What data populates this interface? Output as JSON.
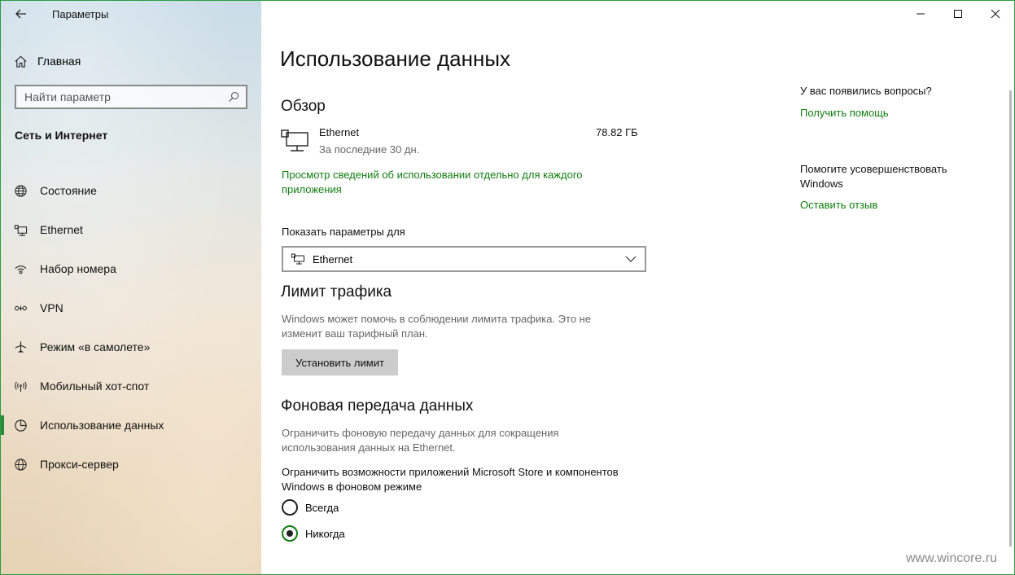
{
  "window": {
    "title": "Параметры",
    "minimize_icon": "minimize-icon",
    "maximize_icon": "maximize-icon",
    "close_icon": "close-icon",
    "accent": "#107c10"
  },
  "sidebar": {
    "home_label": "Главная",
    "search_placeholder": "Найти параметр",
    "section_title": "Сеть и Интернет",
    "items": [
      {
        "label": "Состояние",
        "icon": "globe-status-icon"
      },
      {
        "label": "Ethernet",
        "icon": "ethernet-icon"
      },
      {
        "label": "Набор номера",
        "icon": "dial-up-icon"
      },
      {
        "label": "VPN",
        "icon": "vpn-icon"
      },
      {
        "label": "Режим «в самолете»",
        "icon": "airplane-icon"
      },
      {
        "label": "Мобильный хот-спот",
        "icon": "hotspot-icon"
      },
      {
        "label": "Использование данных",
        "icon": "data-usage-icon",
        "active": true
      },
      {
        "label": "Прокси-сервер",
        "icon": "globe-icon"
      }
    ]
  },
  "main": {
    "title": "Использование данных",
    "overview": {
      "title": "Обзор",
      "network_name": "Ethernet",
      "period": "За последние 30 дн.",
      "usage": "78.82 ГБ",
      "details_link": "Просмотр сведений об использовании отдельно для каждого приложения"
    },
    "show_settings": {
      "label": "Показать параметры для",
      "selected": "Ethernet"
    },
    "limit": {
      "title": "Лимит трафика",
      "description": "Windows может помочь в соблюдении лимита трафика. Это не изменит ваш тарифный план.",
      "button": "Установить лимит"
    },
    "background": {
      "title": "Фоновая передача данных",
      "description": "Ограничить фоновую передачу данных для сокращения использования данных на Ethernet.",
      "restrict_label": "Ограничить возможности приложений Microsoft Store и компонентов Windows в фоновом режиме",
      "options": [
        {
          "label": "Всегда",
          "checked": false
        },
        {
          "label": "Никогда",
          "checked": true
        }
      ]
    }
  },
  "side_panel": {
    "question": "У вас появились вопросы?",
    "help_link": "Получить помощь",
    "improve": "Помогите усовершенствовать Windows",
    "feedback_link": "Оставить отзыв"
  },
  "watermark": "www.wincore.ru"
}
